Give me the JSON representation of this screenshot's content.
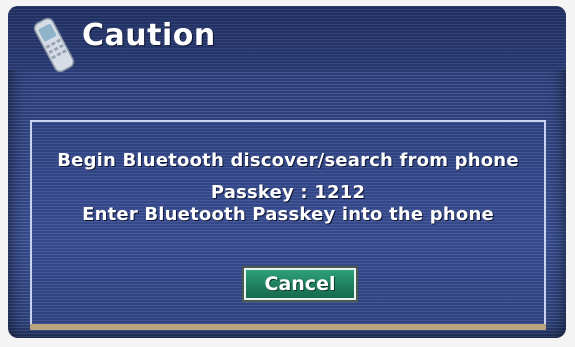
{
  "header": {
    "title": "Caution",
    "icon": "cell-phone-icon"
  },
  "dialog": {
    "message_line1": "Begin Bluetooth discover/search from phone",
    "message_line2": "Passkey : 1212",
    "message_line3": "Enter Bluetooth Passkey into the phone",
    "cancel_label": "Cancel"
  },
  "colors": {
    "background": "#34498a",
    "dialog_border": "#c9d2ef",
    "button": "#1f7f5e",
    "text": "#ffffff"
  }
}
